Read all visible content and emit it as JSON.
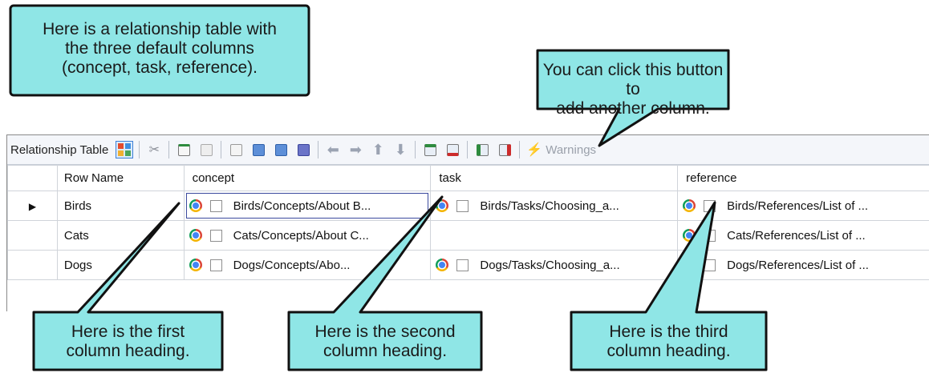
{
  "toolbar": {
    "label": "Relationship Table",
    "warnings_label": "Warnings",
    "buttons": [
      {
        "name": "relationship-table-view-button",
        "icon": "grid-icon"
      },
      {
        "name": "cut-button",
        "icon": "scissors-icon"
      },
      {
        "name": "new-row-button",
        "icon": "add-doc-icon"
      },
      {
        "name": "copy-button",
        "icon": "copy-icon"
      },
      {
        "name": "open-button",
        "icon": "doc-icon"
      },
      {
        "name": "edit-1-button",
        "icon": "edit-icon"
      },
      {
        "name": "edit-2-button",
        "icon": "edit-icon"
      },
      {
        "name": "edit-3-button",
        "icon": "edit-icon"
      },
      {
        "name": "move-left-button",
        "icon": "arrow-left-icon"
      },
      {
        "name": "move-right-button",
        "icon": "arrow-right-icon"
      },
      {
        "name": "move-up-button",
        "icon": "arrow-up-icon"
      },
      {
        "name": "move-down-button",
        "icon": "arrow-down-icon"
      },
      {
        "name": "insert-row-button",
        "icon": "insert-row-icon"
      },
      {
        "name": "delete-row-button",
        "icon": "delete-row-icon"
      },
      {
        "name": "insert-column-button",
        "icon": "insert-column-icon"
      },
      {
        "name": "delete-column-button",
        "icon": "delete-column-icon"
      }
    ]
  },
  "table": {
    "headers": {
      "row_name": "Row Name",
      "concept": "concept",
      "task": "task",
      "reference": "reference"
    },
    "rows": [
      {
        "name": "Birds",
        "concept": "Birds/Concepts/About B...",
        "task": "Birds/Tasks/Choosing_a...",
        "reference": "Birds/References/List of ..."
      },
      {
        "name": "Cats",
        "concept": "Cats/Concepts/About C...",
        "task": "",
        "reference": "Cats/References/List of ..."
      },
      {
        "name": "Dogs",
        "concept": "Dogs/Concepts/Abo...",
        "task": "Dogs/Tasks/Choosing_a...",
        "reference": "Dogs/References/List of ..."
      }
    ]
  },
  "callouts": {
    "intro": [
      "Here is a relationship table with",
      "the three default columns",
      "(concept, task, reference)."
    ],
    "add_column": [
      "You can click this button to",
      "add another column."
    ],
    "first": [
      "Here is the first",
      "column heading."
    ],
    "second": [
      "Here is the second",
      "column heading."
    ],
    "third": [
      "Here is the third",
      "column heading."
    ]
  },
  "colors": {
    "callout_fill": "#8fe6e6",
    "callout_border": "#111111",
    "selection_border": "#3b4a9e"
  }
}
